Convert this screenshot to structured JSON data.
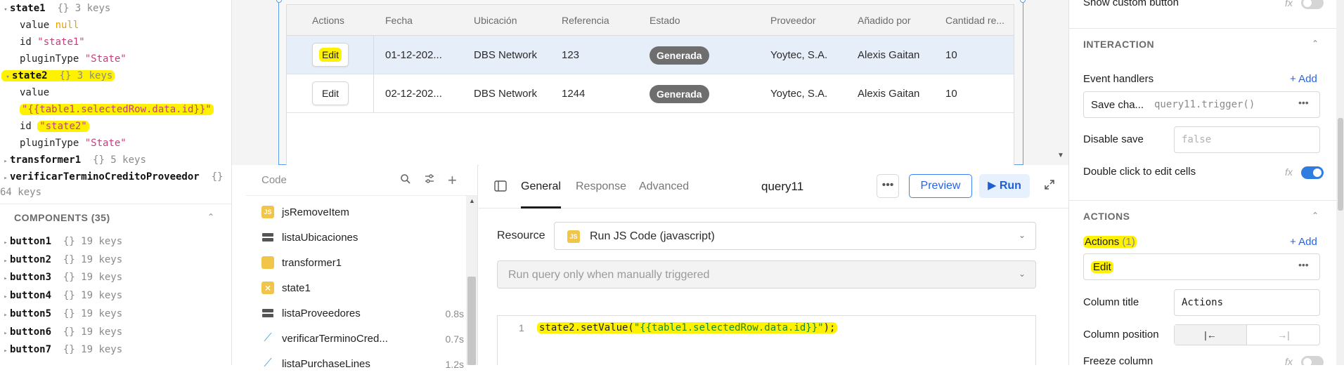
{
  "state_tree": {
    "state1": {
      "name": "state1",
      "meta": "{}  3 keys",
      "value_key": "value",
      "value": "null",
      "id_key": "id",
      "id": "\"state1\"",
      "pt_key": "pluginType",
      "pt": "\"State\""
    },
    "state2": {
      "name": "state2",
      "meta": "{}  3 keys",
      "value_key": "value",
      "value": "\"{{table1.selectedRow.data.id}}\"",
      "id_key": "id",
      "id": "\"state2\"",
      "pt_key": "pluginType",
      "pt": "\"State\""
    },
    "transformer1": {
      "name": "transformer1",
      "meta": "{}  5 keys"
    },
    "verificar": {
      "name": "verificarTerminoCreditoProveedor",
      "meta": "{}",
      "extra": "64 keys"
    }
  },
  "components": {
    "title": "COMPONENTS (35)",
    "items": [
      {
        "name": "button1",
        "meta": "{}  19 keys"
      },
      {
        "name": "button2",
        "meta": "{}  19 keys"
      },
      {
        "name": "button3",
        "meta": "{}  19 keys"
      },
      {
        "name": "button4",
        "meta": "{}  19 keys"
      },
      {
        "name": "button5",
        "meta": "{}  19 keys"
      },
      {
        "name": "button6",
        "meta": "{}  19 keys"
      },
      {
        "name": "button7",
        "meta": "{}  19 keys"
      }
    ]
  },
  "table": {
    "columns": [
      "Actions",
      "Fecha",
      "Ubicación",
      "Referencia",
      "Estado",
      "Proveedor",
      "Añadido por",
      "Cantidad re..."
    ],
    "rows": [
      {
        "action": "Edit",
        "fecha": "01-12-202...",
        "ubicacion": "DBS Network",
        "referencia": "123",
        "estado": "Generada",
        "proveedor": "Yoytec, S.A.",
        "anadido": "Alexis Gaitan",
        "cantidad": "10"
      },
      {
        "action": "Edit",
        "fecha": "02-12-202...",
        "ubicacion": "DBS Network",
        "referencia": "1244",
        "estado": "Generada",
        "proveedor": "Yoytec, S.A.",
        "anadido": "Alexis Gaitan",
        "cantidad": "10"
      }
    ]
  },
  "query_list": {
    "search_placeholder": "Code",
    "items": [
      {
        "label": "jsRemoveItem",
        "type": "js",
        "time": ""
      },
      {
        "label": "listaUbicaciones",
        "type": "db",
        "time": ""
      },
      {
        "label": "transformer1",
        "type": "transformer",
        "time": ""
      },
      {
        "label": "state1",
        "type": "state",
        "time": ""
      },
      {
        "label": "listaProveedores",
        "type": "db",
        "time": "0.8s"
      },
      {
        "label": "verificarTerminoCred...",
        "type": "api",
        "time": "0.7s"
      },
      {
        "label": "listaPurchaseLines",
        "type": "api",
        "time": "1.2s"
      }
    ]
  },
  "query_editor": {
    "tabs": [
      "General",
      "Response",
      "Advanced"
    ],
    "active_tab": "General",
    "name": "query11",
    "preview_label": "Preview",
    "run_label": "Run",
    "resource_label": "Resource",
    "resource_value": "Run JS Code (javascript)",
    "resource_icon": "JS",
    "trigger_value": "Run query only when manually triggered",
    "code_line_number": "1",
    "code_fn": "state2.setValue(",
    "code_str": "\"{{table1.selectedRow.data.id}}\"",
    "code_end": ");"
  },
  "inspector": {
    "show_custom_button": "Show custom button",
    "interaction_title": "INTERACTION",
    "event_handlers": "Event handlers",
    "add_label": "+ Add",
    "handler_event": "Save cha...",
    "handler_action": "query11.trigger()",
    "disable_save": "Disable save",
    "disable_save_value": "false",
    "double_click": "Double click to edit cells",
    "actions_title": "ACTIONS",
    "actions_label": "Actions",
    "actions_count": "(1)",
    "action_item": "Edit",
    "column_title": "Column title",
    "column_title_value": "Actions",
    "column_position": "Column position",
    "freeze_column": "Freeze column",
    "fx": "fx"
  },
  "colors": {
    "accent": "#2563eb",
    "highlight": "#fff200",
    "badge": "#6e6e6e",
    "selected_row": "#e6eff9"
  }
}
